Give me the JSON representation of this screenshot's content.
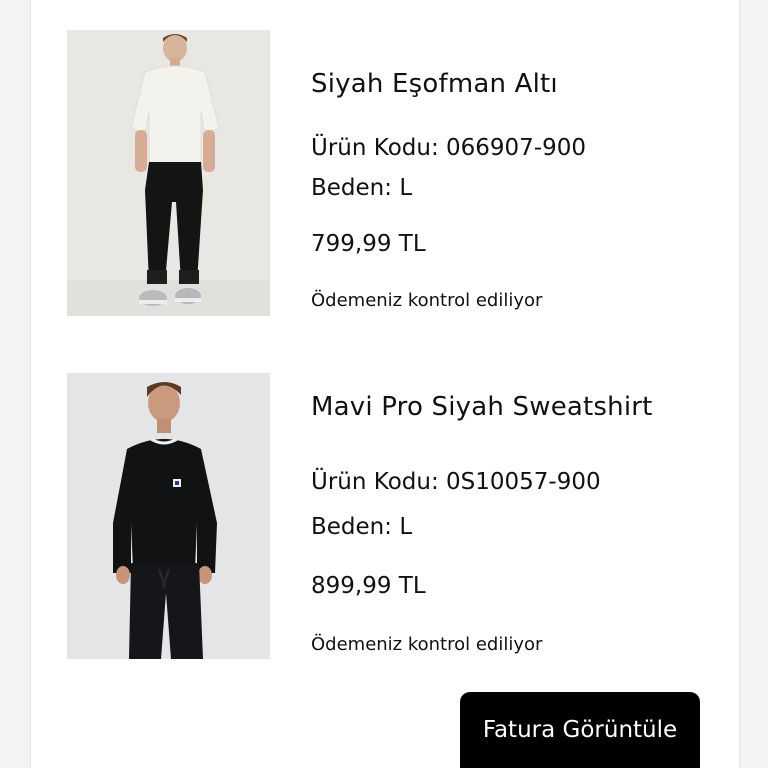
{
  "order": {
    "items": [
      {
        "image_icon": "product-photo-white-tee-black-joggers",
        "name": "Siyah Eşofman Altı",
        "code_text": "Ürün Kodu: 066907-900",
        "size_text": "Beden: L",
        "price": "799,99 TL",
        "status": "Ödemeniz kontrol ediliyor"
      },
      {
        "image_icon": "product-photo-black-sweatshirt",
        "name": "Mavi Pro Siyah Sweatshirt",
        "code_text": "Ürün Kodu: 0S10057-900",
        "size_text": "Beden: L",
        "price": "899,99 TL",
        "status": "Ödemeniz kontrol ediliyor"
      }
    ]
  },
  "actions": {
    "invoice_label": "Fatura Görüntüle"
  },
  "colors": {
    "background": "#f3f3f3",
    "card": "#ffffff",
    "button": "#000000",
    "button_text": "#ffffff"
  }
}
